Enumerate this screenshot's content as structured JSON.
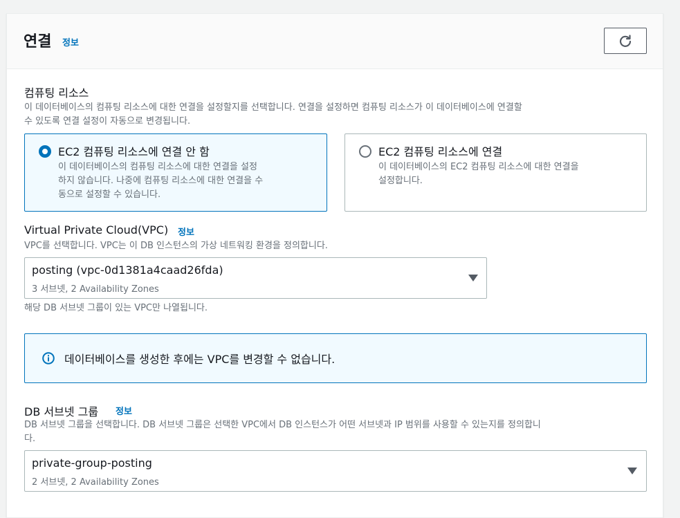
{
  "header": {
    "title": "연결",
    "info": "정보"
  },
  "compute": {
    "label": "컴퓨팅 리소스",
    "description_line1": "이 데이터베이스의 컴퓨팅 리소스에 대한 연결을 설정할지를 선택합니다. 연결을 설정하면 컴퓨팅 리소스가 이 데이터베이스에 연결할",
    "description_line2": "수 있도록 연결 설정이 자동으로 변경됩니다.",
    "options": [
      {
        "title": "EC2 컴퓨팅 리소스에 연결 안 함",
        "desc_line1": "이 데이터베이스의 컴퓨팅 리소스에 대한 연결을 설정",
        "desc_line2": "하지 않습니다. 나중에 컴퓨팅 리소스에 대한 연결을 수",
        "desc_line3": "동으로 설정할 수 있습니다.",
        "selected": true
      },
      {
        "title": "EC2 컴퓨팅 리소스에 연결",
        "desc_line1": "이 데이터베이스의 EC2 컴퓨팅 리소스에 대한 연결을",
        "desc_line2": "설정합니다.",
        "selected": false
      }
    ]
  },
  "vpc": {
    "label": "Virtual Private Cloud(VPC)",
    "info": "정보",
    "description": "VPC를 선택합니다. VPC는 이 DB 인스턴스의 가상 네트워킹 환경을 정의합니다.",
    "selected_value": "posting (vpc-0d1381a4caad26fda)",
    "selected_sub": "3 서브넷, 2 Availability Zones",
    "hint": "해당 DB 서브넷 그룹이 있는 VPC만 나열됩니다."
  },
  "alert": {
    "text": "데이터베이스를 생성한 후에는 VPC를 변경할 수 없습니다."
  },
  "subnet_group": {
    "label": "DB 서브넷 그룹",
    "info": "정보",
    "description_line1": "DB 서브넷 그룹을 선택합니다. DB 서브넷 그룹은 선택한 VPC에서 DB 인스턴스가 어떤 서브넷과 IP 범위를 사용할 수 있는지를 정의합니",
    "description_line2": "다.",
    "selected_value": "private-group-posting",
    "selected_sub": "2 서브넷, 2 Availability Zones"
  },
  "colors": {
    "accent": "#0073bb",
    "text": "#16191f",
    "muted": "#687078"
  }
}
